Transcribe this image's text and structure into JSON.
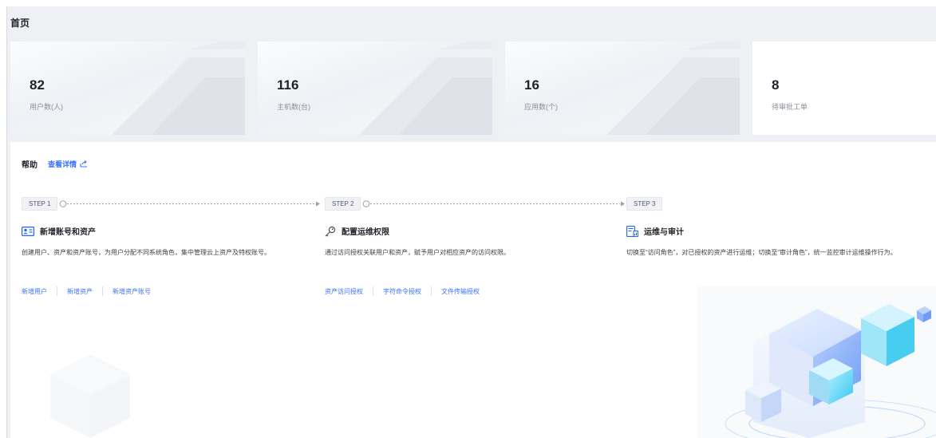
{
  "header": {
    "title": "首页"
  },
  "stats": [
    {
      "value": "82",
      "label": "用户数(人)"
    },
    {
      "value": "116",
      "label": "主机数(台)"
    },
    {
      "value": "16",
      "label": "应用数(个)"
    },
    {
      "value": "8",
      "label": "待审批工单"
    }
  ],
  "help": {
    "title": "帮助",
    "details_link": "查看详情",
    "steps": [
      {
        "tag": "STEP 1",
        "title": "新增账号和资产",
        "icon": "user-card-icon",
        "description": "创建用户、资产和资产账号，为用户分配不同系统角色，集中管理云上资产及特权账号。",
        "links": [
          "新增用户",
          "新增资产",
          "新增资产账号"
        ]
      },
      {
        "tag": "STEP 2",
        "title": "配置运维权限",
        "icon": "key-icon",
        "description": "通过访问授权关联用户和资产，赋予用户对相应资产的访问权限。",
        "links": [
          "资产访问授权",
          "字符命令授权",
          "文件传输授权"
        ]
      },
      {
        "tag": "STEP 3",
        "title": "运维与审计",
        "icon": "audit-report-icon",
        "description": "切换至“访问角色”，对已授权的资产进行运维；切换至“审计角色”，统一监控审计运维操作行为。",
        "links": []
      }
    ]
  },
  "colors": {
    "accent": "#3a72ff",
    "page_bg": "#eef0f3",
    "text": "#1f2329",
    "muted": "#8a9099"
  }
}
